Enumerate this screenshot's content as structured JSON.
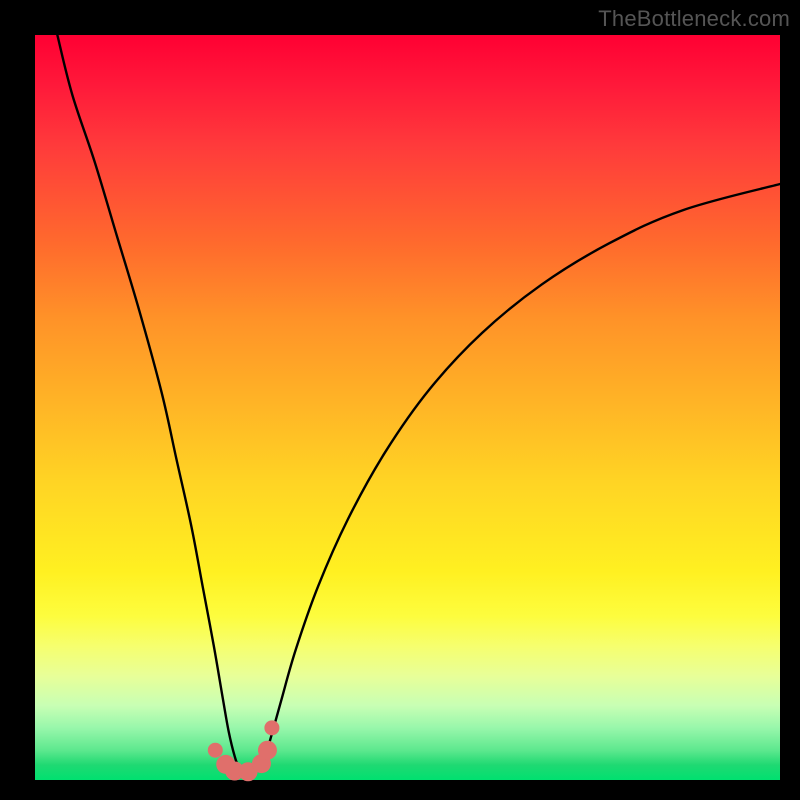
{
  "watermark": "TheBottleneck.com",
  "chart_data": {
    "type": "line",
    "title": "",
    "xlabel": "",
    "ylabel": "",
    "xlim": [
      0,
      100
    ],
    "ylim": [
      0,
      100
    ],
    "grid": false,
    "series": [
      {
        "name": "bottleneck-curve",
        "x": [
          3,
          5,
          8,
          11,
          14,
          17,
          19,
          21,
          22.5,
          24,
          25.2,
          26,
          26.8,
          27.5,
          28.3,
          29,
          30,
          31,
          31.8,
          33,
          35,
          38,
          42,
          47,
          53,
          60,
          68,
          77,
          87,
          100
        ],
        "values": [
          100,
          92,
          83,
          73,
          63,
          52,
          43,
          34,
          26,
          18,
          11,
          6.5,
          3.2,
          1.3,
          0.5,
          0.6,
          1.6,
          3.6,
          6.2,
          10.5,
          17.5,
          26,
          35,
          44,
          52.5,
          60,
          66.5,
          72,
          76.5,
          80
        ]
      }
    ],
    "markers": {
      "name": "highlight-dots",
      "color": "#e06f6b",
      "x": [
        24.2,
        25.6,
        26.8,
        28.6,
        30.4,
        31.2,
        31.8
      ],
      "values": [
        4.0,
        2.1,
        1.2,
        1.1,
        2.2,
        4.0,
        7.0
      ]
    }
  }
}
